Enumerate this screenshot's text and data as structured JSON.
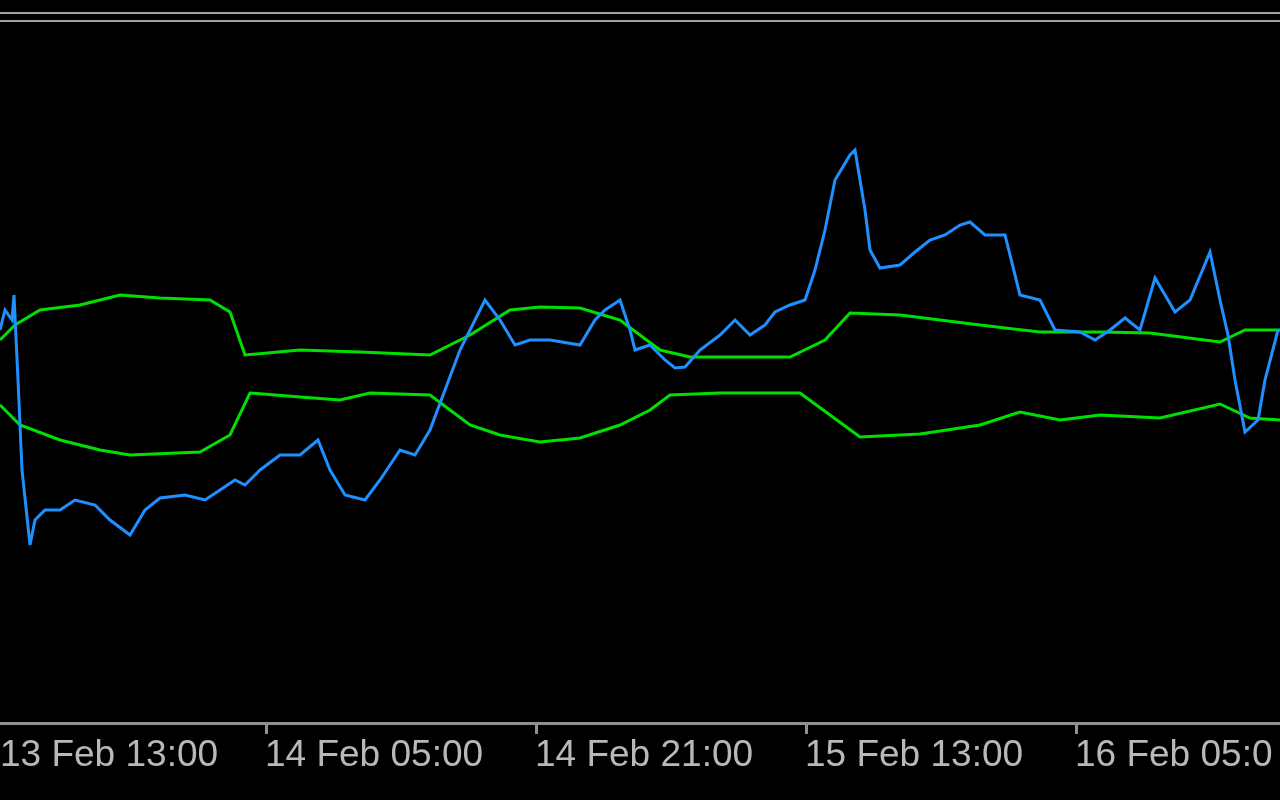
{
  "chart": {
    "x_axis": {
      "labels": [
        "13 Feb 13:00",
        "14 Feb 05:00",
        "14 Feb 21:00",
        "15 Feb 13:00",
        "16 Feb 05:0"
      ]
    }
  }
}
